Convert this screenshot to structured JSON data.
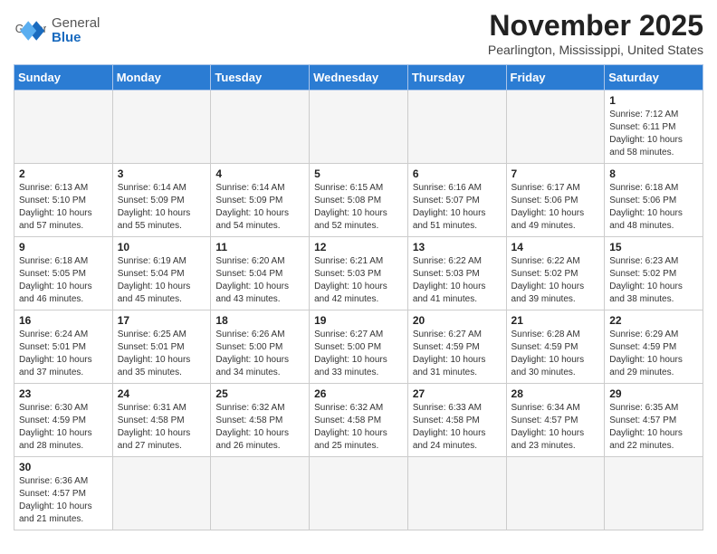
{
  "header": {
    "logo_general": "General",
    "logo_blue": "Blue",
    "month": "November 2025",
    "location": "Pearlington, Mississippi, United States"
  },
  "weekdays": [
    "Sunday",
    "Monday",
    "Tuesday",
    "Wednesday",
    "Thursday",
    "Friday",
    "Saturday"
  ],
  "days": [
    {
      "date": "",
      "info": ""
    },
    {
      "date": "",
      "info": ""
    },
    {
      "date": "",
      "info": ""
    },
    {
      "date": "",
      "info": ""
    },
    {
      "date": "",
      "info": ""
    },
    {
      "date": "",
      "info": ""
    },
    {
      "date": "1",
      "info": "Sunrise: 7:12 AM\nSunset: 6:11 PM\nDaylight: 10 hours and 58 minutes."
    },
    {
      "date": "2",
      "info": "Sunrise: 6:13 AM\nSunset: 5:10 PM\nDaylight: 10 hours and 57 minutes."
    },
    {
      "date": "3",
      "info": "Sunrise: 6:14 AM\nSunset: 5:09 PM\nDaylight: 10 hours and 55 minutes."
    },
    {
      "date": "4",
      "info": "Sunrise: 6:14 AM\nSunset: 5:09 PM\nDaylight: 10 hours and 54 minutes."
    },
    {
      "date": "5",
      "info": "Sunrise: 6:15 AM\nSunset: 5:08 PM\nDaylight: 10 hours and 52 minutes."
    },
    {
      "date": "6",
      "info": "Sunrise: 6:16 AM\nSunset: 5:07 PM\nDaylight: 10 hours and 51 minutes."
    },
    {
      "date": "7",
      "info": "Sunrise: 6:17 AM\nSunset: 5:06 PM\nDaylight: 10 hours and 49 minutes."
    },
    {
      "date": "8",
      "info": "Sunrise: 6:18 AM\nSunset: 5:06 PM\nDaylight: 10 hours and 48 minutes."
    },
    {
      "date": "9",
      "info": "Sunrise: 6:18 AM\nSunset: 5:05 PM\nDaylight: 10 hours and 46 minutes."
    },
    {
      "date": "10",
      "info": "Sunrise: 6:19 AM\nSunset: 5:04 PM\nDaylight: 10 hours and 45 minutes."
    },
    {
      "date": "11",
      "info": "Sunrise: 6:20 AM\nSunset: 5:04 PM\nDaylight: 10 hours and 43 minutes."
    },
    {
      "date": "12",
      "info": "Sunrise: 6:21 AM\nSunset: 5:03 PM\nDaylight: 10 hours and 42 minutes."
    },
    {
      "date": "13",
      "info": "Sunrise: 6:22 AM\nSunset: 5:03 PM\nDaylight: 10 hours and 41 minutes."
    },
    {
      "date": "14",
      "info": "Sunrise: 6:22 AM\nSunset: 5:02 PM\nDaylight: 10 hours and 39 minutes."
    },
    {
      "date": "15",
      "info": "Sunrise: 6:23 AM\nSunset: 5:02 PM\nDaylight: 10 hours and 38 minutes."
    },
    {
      "date": "16",
      "info": "Sunrise: 6:24 AM\nSunset: 5:01 PM\nDaylight: 10 hours and 37 minutes."
    },
    {
      "date": "17",
      "info": "Sunrise: 6:25 AM\nSunset: 5:01 PM\nDaylight: 10 hours and 35 minutes."
    },
    {
      "date": "18",
      "info": "Sunrise: 6:26 AM\nSunset: 5:00 PM\nDaylight: 10 hours and 34 minutes."
    },
    {
      "date": "19",
      "info": "Sunrise: 6:27 AM\nSunset: 5:00 PM\nDaylight: 10 hours and 33 minutes."
    },
    {
      "date": "20",
      "info": "Sunrise: 6:27 AM\nSunset: 4:59 PM\nDaylight: 10 hours and 31 minutes."
    },
    {
      "date": "21",
      "info": "Sunrise: 6:28 AM\nSunset: 4:59 PM\nDaylight: 10 hours and 30 minutes."
    },
    {
      "date": "22",
      "info": "Sunrise: 6:29 AM\nSunset: 4:59 PM\nDaylight: 10 hours and 29 minutes."
    },
    {
      "date": "23",
      "info": "Sunrise: 6:30 AM\nSunset: 4:59 PM\nDaylight: 10 hours and 28 minutes."
    },
    {
      "date": "24",
      "info": "Sunrise: 6:31 AM\nSunset: 4:58 PM\nDaylight: 10 hours and 27 minutes."
    },
    {
      "date": "25",
      "info": "Sunrise: 6:32 AM\nSunset: 4:58 PM\nDaylight: 10 hours and 26 minutes."
    },
    {
      "date": "26",
      "info": "Sunrise: 6:32 AM\nSunset: 4:58 PM\nDaylight: 10 hours and 25 minutes."
    },
    {
      "date": "27",
      "info": "Sunrise: 6:33 AM\nSunset: 4:58 PM\nDaylight: 10 hours and 24 minutes."
    },
    {
      "date": "28",
      "info": "Sunrise: 6:34 AM\nSunset: 4:57 PM\nDaylight: 10 hours and 23 minutes."
    },
    {
      "date": "29",
      "info": "Sunrise: 6:35 AM\nSunset: 4:57 PM\nDaylight: 10 hours and 22 minutes."
    },
    {
      "date": "30",
      "info": "Sunrise: 6:36 AM\nSunset: 4:57 PM\nDaylight: 10 hours and 21 minutes."
    },
    {
      "date": "",
      "info": ""
    },
    {
      "date": "",
      "info": ""
    },
    {
      "date": "",
      "info": ""
    },
    {
      "date": "",
      "info": ""
    },
    {
      "date": "",
      "info": ""
    }
  ]
}
